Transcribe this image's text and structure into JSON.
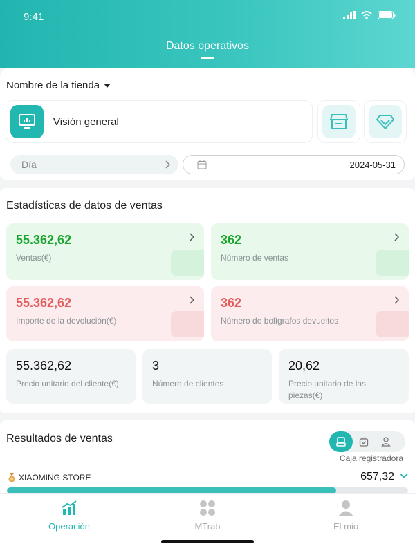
{
  "status_bar": {
    "time": "9:41"
  },
  "header": {
    "title": "Datos operativos"
  },
  "store_selector": {
    "label": "Nombre de la tienda"
  },
  "overview": {
    "label": "Visión general"
  },
  "period": {
    "label": "Día"
  },
  "date": {
    "value": "2024-05-31"
  },
  "sales_stats": {
    "title": "Estadísticas de datos de ventas",
    "sales": {
      "value": "55.362,62",
      "label": "Ventas(€)"
    },
    "sales_count": {
      "value": "362",
      "label": "Número de ventas"
    },
    "refund_amount": {
      "value": "55.362,62",
      "label": "Importe de la devolución(€)"
    },
    "returned_count": {
      "value": "362",
      "label": "Número de bolígrafos devueltos"
    },
    "customer_unit_price": {
      "value": "55.362,62",
      "label": "Precio unitario del cliente(€)"
    },
    "customers": {
      "value": "3",
      "label": "Número de clientes"
    },
    "piece_unit_price": {
      "value": "20,62",
      "label": "Precio unitario de las piezas(€)"
    }
  },
  "sales_results": {
    "title": "Resultados de ventas",
    "mode_caption": "Caja registradora",
    "store": {
      "name": "XIAOMING STORE",
      "value": "657,32",
      "progress": 0.82
    }
  },
  "tabs": [
    {
      "label": "Operación",
      "active": true
    },
    {
      "label": "MTrab",
      "active": false
    },
    {
      "label": "El mio",
      "active": false
    }
  ],
  "colors": {
    "accent": "#23b7b2",
    "green": "#1aa430",
    "red": "#e35d5d"
  }
}
